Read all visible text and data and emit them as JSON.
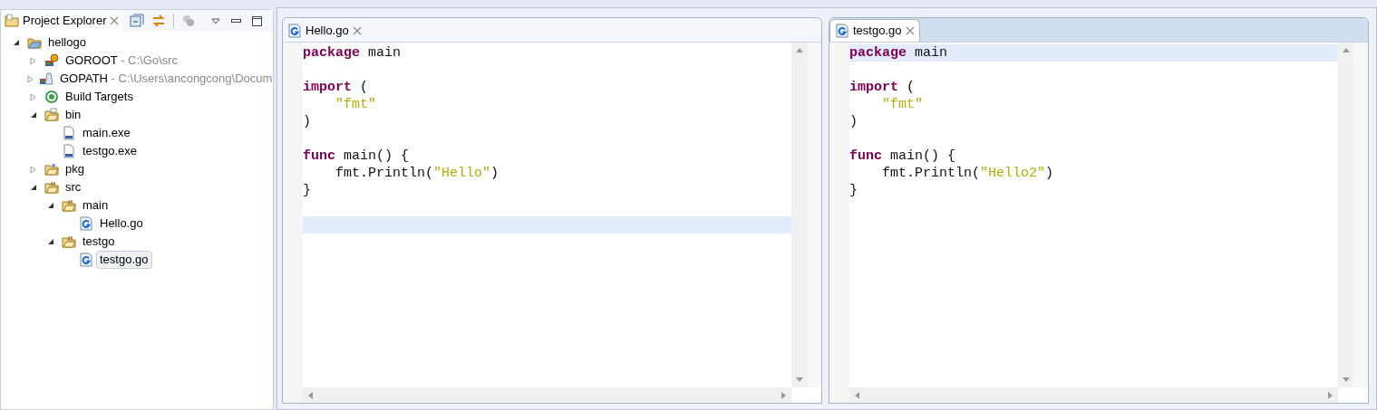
{
  "explorer": {
    "title": "Project Explorer",
    "tree": [
      {
        "label": "hellogo",
        "kind": "project",
        "expanded": true,
        "selected": false,
        "children": [
          {
            "label": "GOROOT",
            "suffix": " - C:\\Go\\src",
            "kind": "goroot",
            "expanded": false,
            "selected": false
          },
          {
            "label": "GOPATH",
            "suffix": " - C:\\Users\\ancongcong\\Docum",
            "kind": "gopath",
            "expanded": false,
            "selected": false
          },
          {
            "label": "Build Targets",
            "kind": "target",
            "expanded": false,
            "selected": false
          },
          {
            "label": "bin",
            "kind": "binfolder",
            "expanded": true,
            "selected": false,
            "children": [
              {
                "label": "main.exe",
                "kind": "binary",
                "selected": false
              },
              {
                "label": "testgo.exe",
                "kind": "binary",
                "selected": false
              }
            ]
          },
          {
            "label": "pkg",
            "kind": "pkgfolder",
            "expanded": false,
            "selected": false
          },
          {
            "label": "src",
            "kind": "srcfolder",
            "expanded": true,
            "selected": false,
            "children": [
              {
                "label": "main",
                "kind": "srcfolder",
                "expanded": true,
                "selected": false,
                "children": [
                  {
                    "label": "Hello.go",
                    "kind": "gofile",
                    "selected": false
                  }
                ]
              },
              {
                "label": "testgo",
                "kind": "srcfolder",
                "expanded": true,
                "selected": false,
                "children": [
                  {
                    "label": "testgo.go",
                    "kind": "gofile",
                    "selected": true
                  }
                ]
              }
            ]
          }
        ]
      }
    ]
  },
  "editors": [
    {
      "tab": {
        "label": "Hello.go",
        "selected": false
      },
      "lines": [
        {
          "current": false,
          "indented": false,
          "tokens": [
            {
              "kind": "keyword",
              "text": "package"
            },
            {
              "kind": "plain",
              "text": " main"
            }
          ]
        },
        {
          "current": false
        },
        {
          "current": false,
          "indented": false,
          "tokens": [
            {
              "kind": "keyword",
              "text": "import"
            },
            {
              "kind": "plain",
              "text": " ("
            }
          ]
        },
        {
          "current": false,
          "indented": true,
          "tokens": [
            {
              "kind": "string",
              "text": "\"fmt\""
            }
          ]
        },
        {
          "current": false,
          "indented": false,
          "tokens": [
            {
              "kind": "plain",
              "text": ")"
            }
          ]
        },
        {
          "current": false
        },
        {
          "current": false,
          "indented": false,
          "tokens": [
            {
              "kind": "keyword",
              "text": "func"
            },
            {
              "kind": "plain",
              "text": " main() {"
            }
          ]
        },
        {
          "current": false,
          "indented": true,
          "tokens": [
            {
              "kind": "plain",
              "text": "fmt.Println("
            },
            {
              "kind": "string",
              "text": "\"Hello\""
            },
            {
              "kind": "plain",
              "text": ")"
            }
          ]
        },
        {
          "current": false,
          "indented": false,
          "tokens": [
            {
              "kind": "plain",
              "text": "}"
            }
          ]
        },
        {
          "current": false
        },
        {
          "current": true
        }
      ]
    },
    {
      "tab": {
        "label": "testgo.go",
        "selected": true
      },
      "lines": [
        {
          "current": true,
          "indented": false,
          "tokens": [
            {
              "kind": "keyword",
              "text": "package"
            },
            {
              "kind": "plain",
              "text": " main"
            }
          ]
        },
        {
          "current": false
        },
        {
          "current": false,
          "indented": false,
          "tokens": [
            {
              "kind": "keyword",
              "text": "import"
            },
            {
              "kind": "plain",
              "text": " ("
            }
          ]
        },
        {
          "current": false,
          "indented": true,
          "tokens": [
            {
              "kind": "string",
              "text": "\"fmt\""
            }
          ]
        },
        {
          "current": false,
          "indented": false,
          "tokens": [
            {
              "kind": "plain",
              "text": ")"
            }
          ]
        },
        {
          "current": false
        },
        {
          "current": false,
          "indented": false,
          "tokens": [
            {
              "kind": "keyword",
              "text": "func"
            },
            {
              "kind": "plain",
              "text": " main() {"
            }
          ]
        },
        {
          "current": false,
          "indented": true,
          "tokens": [
            {
              "kind": "plain",
              "text": "fmt.Println("
            },
            {
              "kind": "string",
              "text": "\"Hello2\""
            },
            {
              "kind": "plain",
              "text": ")"
            }
          ]
        },
        {
          "current": false,
          "indented": false,
          "tokens": [
            {
              "kind": "plain",
              "text": "}"
            }
          ]
        }
      ]
    }
  ]
}
